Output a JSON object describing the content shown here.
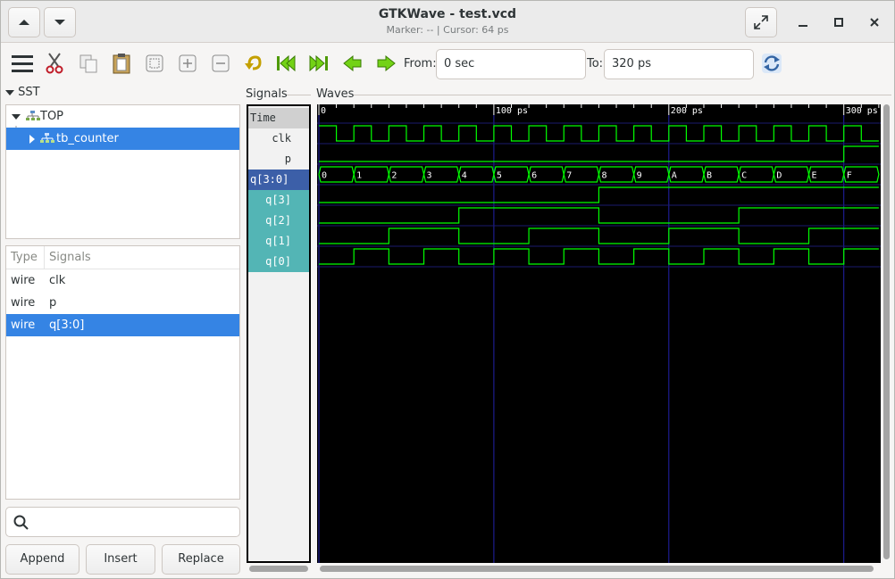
{
  "window": {
    "title": "GTKWave - test.vcd",
    "subtitle": "Marker: --  |  Cursor: 64 ps"
  },
  "toolbar": {
    "from_label": "From:",
    "from_value": "0 sec",
    "to_label": "To:",
    "to_value": "320 ps"
  },
  "sst": {
    "header": "SST",
    "tree": [
      {
        "label": "TOP",
        "expanded": true,
        "selected": false
      },
      {
        "label": "tb_counter",
        "expanded": false,
        "selected": true
      }
    ]
  },
  "signal_list": {
    "columns": [
      "Type",
      "Signals"
    ],
    "rows": [
      {
        "type": "wire",
        "name": "clk",
        "selected": false
      },
      {
        "type": "wire",
        "name": "p",
        "selected": false
      },
      {
        "type": "wire",
        "name": "q[3:0]",
        "selected": true
      }
    ],
    "search_placeholder": ""
  },
  "buttons": {
    "append": "Append",
    "insert": "Insert",
    "replace": "Replace"
  },
  "signals_pane": {
    "header": "Signals",
    "time_label": "Time",
    "signals": [
      "clk",
      "p",
      "q[3:0]",
      "q[3]",
      "q[2]",
      "q[1]",
      "q[0]"
    ]
  },
  "waves_pane": {
    "header": "Waves",
    "time_range": [
      0,
      320
    ],
    "time_unit": "ps",
    "ticks": [
      {
        "t": 0,
        "label": "0"
      },
      {
        "t": 100,
        "label": "100 ps"
      },
      {
        "t": 200,
        "label": "200 ps"
      },
      {
        "t": 300,
        "label": "300 ps"
      }
    ],
    "clk_half_period": 10,
    "p_rise_time": 300,
    "bus_values": [
      "0",
      "1",
      "2",
      "3",
      "4",
      "5",
      "6",
      "7",
      "8",
      "9",
      "A",
      "B",
      "C",
      "D",
      "E",
      "F"
    ],
    "bus_step": 20,
    "colors": {
      "background": "#000000",
      "trace": "#00ff00",
      "grid": "#2222aa",
      "label": "#ffffff",
      "highlight_signal": "#3c5fa8",
      "bit_signal": "#53b5b5"
    }
  }
}
